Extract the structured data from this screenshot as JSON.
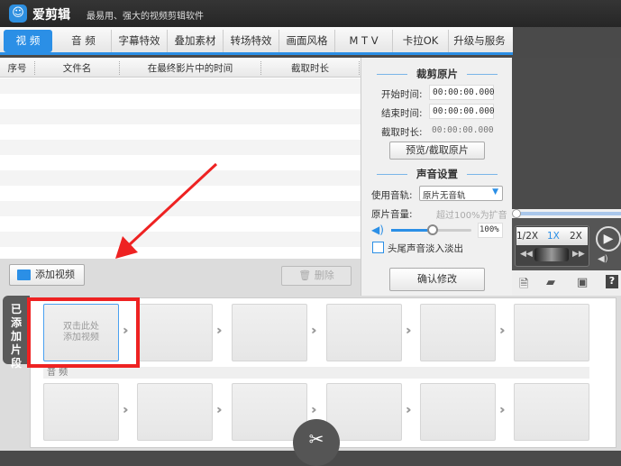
{
  "app": {
    "name": "爱剪辑",
    "slogan": "最易用、强大的视频剪辑软件"
  },
  "tabs": [
    "视 频",
    "音 频",
    "字幕特效",
    "叠加素材",
    "转场特效",
    "画面风格",
    "M T V",
    "卡拉OK",
    "升级与服务"
  ],
  "table": {
    "columns": [
      "序号",
      "文件名",
      "在最终影片中的时间",
      "截取时长"
    ]
  },
  "trim": {
    "title": "裁剪原片",
    "start_label": "开始时间:",
    "start_value": "00:00:00.000",
    "end_label": "结束时间:",
    "end_value": "00:00:00.000",
    "duration_label": "截取时长:",
    "duration_value": "00:00:00.000",
    "preview_button": "预览/截取原片"
  },
  "audio": {
    "title": "声音设置",
    "track_label": "使用音轨:",
    "track_value": "原片无音轨",
    "volume_label": "原片音量:",
    "volume_hint": "超过100%为扩音",
    "volume_value": "100%",
    "volume_percent": 100,
    "fade_label": "头尾声音淡入淡出",
    "confirm_button": "确认修改"
  },
  "player": {
    "speeds": [
      "1/2X",
      "1X",
      "2X"
    ],
    "selected_speed": "1X"
  },
  "toolbar": {
    "add_video": "添加视频",
    "delete": "删除"
  },
  "clips": {
    "side_tab": "已添加片段",
    "placeholder": "双击此处\n添加视频",
    "audio_label": "音 频"
  },
  "colors": {
    "accent": "#2b8fe6",
    "highlight": "#ee2222"
  }
}
